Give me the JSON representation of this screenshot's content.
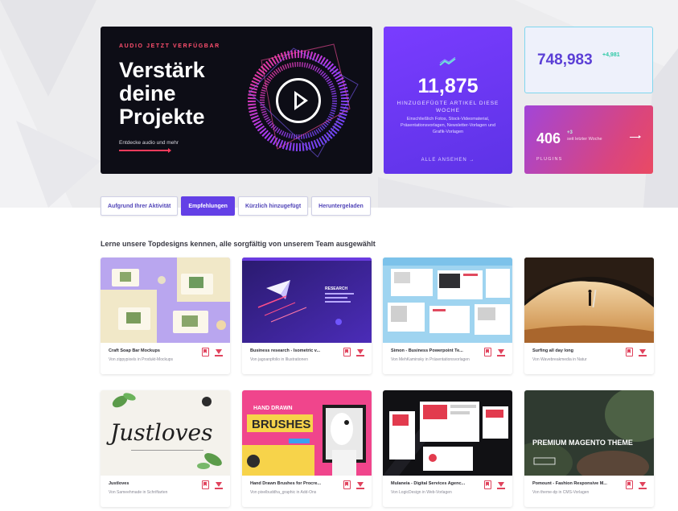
{
  "hero": {
    "banner": {
      "eyebrow": "AUDIO JETZT VERFÜGBAR",
      "headline": "Verstärk deine Projekte",
      "subline": "Entdecke audio und mehr"
    },
    "added_stat": {
      "value": "11,875",
      "caption": "HINZUGEFÜGTE ARTIKEL DIESE WOCHE",
      "description": "Einschließlich Fotos, Stock-Videomaterial, Präsentationsvorlagen, Newsletter-Vorlagen und Grafik-Vorlagen",
      "link_label": "ALLE ANSEHEN →"
    },
    "total_stat": {
      "value": "748,983",
      "delta": "+4,981"
    },
    "plugin_stat": {
      "value": "406",
      "delta": "+3",
      "sub": "seit letzter Woche",
      "label": "PLUGINS"
    }
  },
  "tabs": [
    {
      "label": "Aufgrund Ihrer Aktivität",
      "active": false
    },
    {
      "label": "Empfehlungen",
      "active": true
    },
    {
      "label": "Kürzlich hinzugefügt",
      "active": false
    },
    {
      "label": "Heruntergeladen",
      "active": false
    }
  ],
  "section_title": "Lerne unsere Topdesigns kennen, alle sorgfältig von unserem Team ausgewählt",
  "cards": [
    {
      "name": "Craft Soap Bar Mockups",
      "byline": "Von zippypixels in Produkt-Mockups"
    },
    {
      "name": "Business research - Isometric v...",
      "byline": "Von jagoanpfolio in Illustrationen"
    },
    {
      "name": "Simon - Business Powerpoint Te...",
      "byline": "Von MehKaminsky in Präsentationsvorlagen"
    },
    {
      "name": "Surfing all day long",
      "byline": "Von Wavebreakmedia in Natur"
    },
    {
      "name": "Justloves",
      "byline": "Von Sameehmade in Schriftarten"
    },
    {
      "name": "Hand Drawn Brushes for Procre...",
      "byline": "Von pixelbuddha_graphic in Add-Ons"
    },
    {
      "name": "Mulaneia - Digital Services Agenc...",
      "byline": "Von LogicDesign in Web-Vorlagen"
    },
    {
      "name": "Pomount - Fashion Responsive M...",
      "byline": "Von theme-dp in CMS-Vorlagen"
    }
  ],
  "card_thumbs": {
    "brushes_title": "BRUSHES",
    "brushes_tag": "HAND DRAWN",
    "justloves_script": "Justloves",
    "magento_title": "PREMIUM MAGENTO THEME"
  },
  "colors": {
    "accent": "#6340e6",
    "danger": "#e0435d",
    "delta_green": "#2ec9a6"
  }
}
